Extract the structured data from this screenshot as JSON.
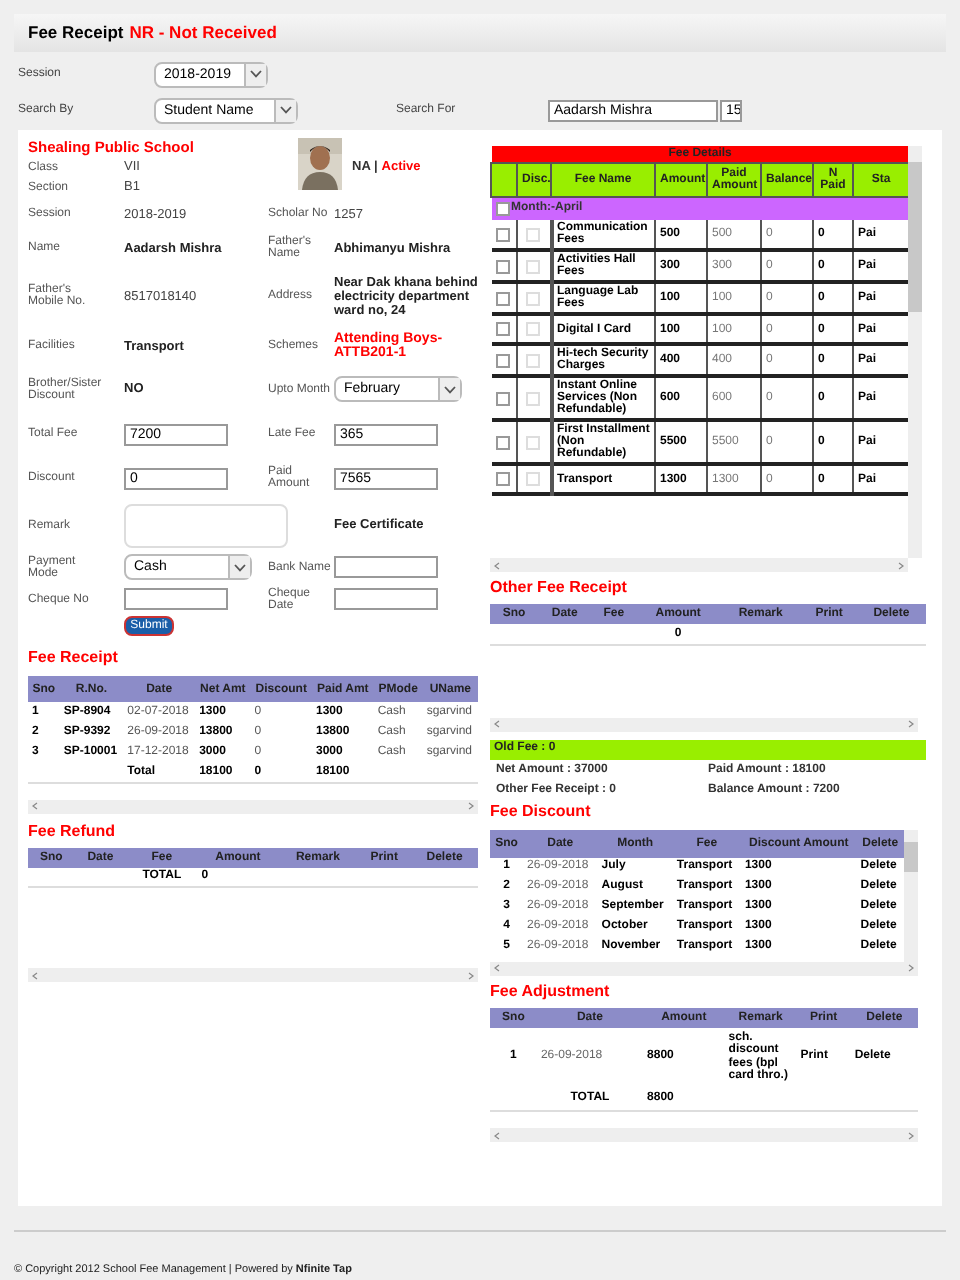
{
  "header": {
    "title": "Fee Receipt",
    "status": "NR - Not Received"
  },
  "filters": [
    {
      "label": "Session",
      "value": "2018-2019",
      "kind": "select"
    },
    {
      "label": "Search By",
      "value": "Student Name",
      "kind": "select",
      "search_label": "Search For",
      "search_value": "Aadarsh Mishra",
      "search_extra": "15"
    }
  ],
  "student": {
    "school": "Shealing Public School",
    "status_prefix": "NA |",
    "status": "Active",
    "top": [
      {
        "label": "Class",
        "value": "VII"
      },
      {
        "label": "Section",
        "value": "B1"
      }
    ],
    "rows": [
      {
        "left": {
          "label": "Session",
          "value": "2018-2019",
          "kind": "text"
        },
        "right": {
          "label": "Scholar No",
          "value": "1257",
          "kind": "text"
        }
      },
      {
        "left": {
          "label": "Name",
          "value": "Aadarsh Mishra",
          "kind": "bold"
        },
        "right": {
          "label": "Father's Name",
          "value": "Abhimanyu Mishra",
          "kind": "bold"
        }
      },
      {
        "left": {
          "label": "Father's Mobile No.",
          "value": "8517018140",
          "kind": "text"
        },
        "right": {
          "label": "Address",
          "value": "Near Dak khana behind electricity department ward no, 24",
          "kind": "bold"
        }
      },
      {
        "left": {
          "label": "Facilities",
          "value": "Transport",
          "kind": "bold"
        },
        "right": {
          "label": "Schemes",
          "value": "Attending Boys-ATTB201-1",
          "kind": "red"
        }
      },
      {
        "left": {
          "label": "Brother/Sister Discount",
          "value": "NO",
          "kind": "bold"
        },
        "right": {
          "label": "Upto Month",
          "value": "February",
          "kind": "select"
        }
      },
      {
        "left": {
          "label": "Total Fee",
          "value": "7200",
          "kind": "input"
        },
        "right": {
          "label": "Late Fee",
          "value": "365",
          "kind": "input"
        }
      },
      {
        "left": {
          "label": "Discount",
          "value": "0",
          "kind": "input"
        },
        "right": {
          "label": "Paid Amount",
          "value": "7565",
          "kind": "input"
        }
      },
      {
        "left": {
          "label": "Remark",
          "kind": "textarea"
        },
        "right": {
          "value": "Fee Certificate",
          "kind": "bold"
        }
      },
      {
        "left": {
          "label": "Payment Mode",
          "value": "Cash",
          "kind": "select"
        },
        "right": {
          "label": "Bank Name",
          "kind": "input"
        }
      },
      {
        "left": {
          "label": "Cheque No",
          "kind": "input"
        },
        "right": {
          "label": "Cheque Date",
          "kind": "input"
        }
      }
    ],
    "submit": "Submit"
  },
  "fee_receipt": {
    "title": "Fee Receipt",
    "columns": [
      "Sno",
      "R.No.",
      "Date",
      "Net Amt",
      "Discount",
      "Paid Amt",
      "PMode",
      "UName"
    ],
    "rows": [
      [
        "1",
        "SP-8904",
        "02-07-2018",
        "1300",
        "0",
        "1300",
        "Cash",
        "sgarvind"
      ],
      [
        "2",
        "SP-9392",
        "26-09-2018",
        "13800",
        "0",
        "13800",
        "Cash",
        "sgarvind"
      ],
      [
        "3",
        "SP-10001",
        "17-12-2018",
        "3000",
        "0",
        "3000",
        "Cash",
        "sgarvind"
      ]
    ],
    "total": {
      "label": "Total",
      "net": "18100",
      "discount": "0",
      "paid": "18100"
    }
  },
  "fee_refund": {
    "title": "Fee Refund",
    "columns": [
      "Sno",
      "Date",
      "Fee",
      "Amount",
      "Remark",
      "Print",
      "Delete"
    ],
    "total": {
      "label": "TOTAL",
      "value": "0"
    }
  },
  "fee_details": {
    "title": "Fee Details",
    "columns": [
      "",
      "Disc.",
      "Fee Name",
      "Amount",
      "Paid Amount",
      "Balance",
      "N Paid",
      "Sta"
    ],
    "month": {
      "label": "Month:-April",
      "checked": false
    },
    "rows": [
      {
        "checked": false,
        "disc_checked": false,
        "cells": [
          "",
          "",
          "Communication Fees",
          "500",
          "500",
          "0",
          "0",
          "Pai"
        ]
      },
      {
        "checked": false,
        "disc_checked": false,
        "cells": [
          "",
          "",
          "Activities Hall Fees",
          "300",
          "300",
          "0",
          "0",
          "Pai"
        ]
      },
      {
        "checked": false,
        "disc_checked": false,
        "cells": [
          "",
          "",
          "Language Lab Fees",
          "100",
          "100",
          "0",
          "0",
          "Pai"
        ]
      },
      {
        "checked": false,
        "disc_checked": false,
        "cells": [
          "",
          "",
          "Digital I Card",
          "100",
          "100",
          "0",
          "0",
          "Pai"
        ]
      },
      {
        "checked": false,
        "disc_checked": false,
        "cells": [
          "",
          "",
          "Hi-tech Security Charges",
          "400",
          "400",
          "0",
          "0",
          "Pai"
        ]
      },
      {
        "checked": false,
        "disc_checked": false,
        "cells": [
          "",
          "",
          "Instant Online Services (Non Refundable)",
          "600",
          "600",
          "0",
          "0",
          "Pai"
        ]
      },
      {
        "checked": false,
        "disc_checked": false,
        "cells": [
          "",
          "",
          "First Installment (Non Refundable)",
          "5500",
          "5500",
          "0",
          "0",
          "Pai"
        ]
      },
      {
        "checked": false,
        "disc_checked": false,
        "cells": [
          "",
          "",
          "Transport",
          "1300",
          "1300",
          "0",
          "0",
          "Pai"
        ]
      }
    ]
  },
  "other_fee_receipt": {
    "title": "Other Fee Receipt",
    "columns": [
      "Sno",
      "Date",
      "Fee",
      "Amount",
      "Remark",
      "Print",
      "Delete"
    ],
    "total": "0"
  },
  "summary": {
    "old_fee": "Old Fee : 0",
    "net_amount": "Net Amount : 37000",
    "paid_amount": "Paid Amount : 18100",
    "other_fee_receipt": "Other Fee Receipt : 0",
    "balance_amount": "Balance Amount : 7200"
  },
  "fee_discount": {
    "title": "Fee Discount",
    "columns": [
      "Sno",
      "Date",
      "Month",
      "Fee",
      "Discount Amount",
      "Delete"
    ],
    "rows": [
      [
        "1",
        "26-09-2018",
        "July",
        "Transport",
        "1300",
        "Delete"
      ],
      [
        "2",
        "26-09-2018",
        "August",
        "Transport",
        "1300",
        "Delete"
      ],
      [
        "3",
        "26-09-2018",
        "September",
        "Transport",
        "1300",
        "Delete"
      ],
      [
        "4",
        "26-09-2018",
        "October",
        "Transport",
        "1300",
        "Delete"
      ],
      [
        "5",
        "26-09-2018",
        "November",
        "Transport",
        "1300",
        "Delete"
      ]
    ]
  },
  "fee_adjustment": {
    "title": "Fee Adjustment",
    "columns": [
      "Sno",
      "Date",
      "Amount",
      "Remark",
      "Print",
      "Delete"
    ],
    "rows": [
      [
        "1",
        "26-09-2018",
        "8800",
        "sch. discount fees (bpl card thro.)",
        "Print",
        "Delete"
      ]
    ],
    "total": {
      "label": "TOTAL",
      "value": "8800"
    }
  },
  "footer": "© Copyright 2012 School Fee Management | Powered by **Nfinite Tap**"
}
